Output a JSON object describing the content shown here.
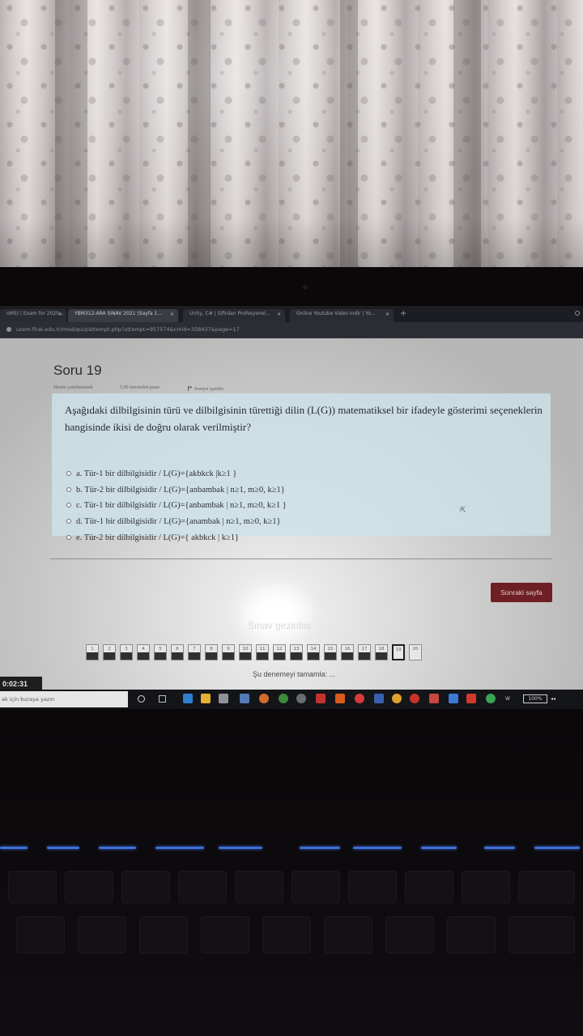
{
  "browser": {
    "tabs": [
      {
        "label": "oMS) | Exam for 2020...",
        "active": false
      },
      {
        "label": "YBM312-ARA SINAV 2021 (Sayfa 1...",
        "active": true
      },
      {
        "label": "Unity, C# | Sifirdan Profesyonel...",
        "active": false
      },
      {
        "label": "Online Youtube Video Indir | Yo...",
        "active": false
      }
    ],
    "new_tab": "+",
    "url": "uzem.firat.edu.tr/mod/quiz/attempt.php?attempt=957574&cmid=358437&page=17"
  },
  "question": {
    "title": "Soru 19",
    "status": "Henüz yanıtlanmadı",
    "points": "5,00 üzerinden puan",
    "flag_label": "Soruyu işaretle",
    "text": "Aşağıdaki dilbilgisinin türü ve dilbilgisinin türettiği dilin (L(G)) matematiksel bir ifadeyle gösterimi seçeneklerin hangisinde ikisi de doğru olarak verilmiştir?",
    "options": [
      "a. Tür-1 bir dilbilgisidir /  L(G)={akbkck |k≥1 }",
      "b. Tür-2 bir dilbilgisidir /  L(G)={anbambak | n≥1, m≥0, k≥1}",
      "c. Tür-1 bir dilbilgisidir /  L(G)={anbambak | n≥1, m≥0, k≥1 }",
      "d. Tür-1 bir dilbilgisidir /  L(G)={anambak | n≥1, m≥0, k≥1}",
      "e. Tür-2 bir dilbilgisidir /  L(G)={ akbkck | k≥1}"
    ]
  },
  "next_button": "Sonraki sayfa",
  "quiz_nav": {
    "title": "Sınav gezintisi",
    "pages": [
      {
        "n": "1",
        "state": "answered"
      },
      {
        "n": "2",
        "state": "answered"
      },
      {
        "n": "3",
        "state": "answered"
      },
      {
        "n": "4",
        "state": "answered"
      },
      {
        "n": "5",
        "state": "answered"
      },
      {
        "n": "6",
        "state": "answered"
      },
      {
        "n": "7",
        "state": "answered"
      },
      {
        "n": "8",
        "state": "answered"
      },
      {
        "n": "9",
        "state": "answered"
      },
      {
        "n": "10",
        "state": "answered"
      },
      {
        "n": "11",
        "state": "answered"
      },
      {
        "n": "12",
        "state": "answered"
      },
      {
        "n": "13",
        "state": "answered"
      },
      {
        "n": "14",
        "state": "answered"
      },
      {
        "n": "15",
        "state": "answered"
      },
      {
        "n": "16",
        "state": "answered"
      },
      {
        "n": "17",
        "state": "answered"
      },
      {
        "n": "18",
        "state": "answered"
      },
      {
        "n": "19",
        "state": "current"
      },
      {
        "n": "20",
        "state": "open"
      }
    ],
    "finish": "Şu denemeyi tamamla: ..."
  },
  "timer": "0:02:31",
  "taskbar": {
    "search_placeholder": "ak için buraya yazın",
    "battery": "100%",
    "tray": "W"
  },
  "colors": {
    "accent_button": "#6e1f23",
    "question_card": "#cde2ea",
    "taskbar": "#141518",
    "keyboard_backlight": "#3f6fd8"
  }
}
